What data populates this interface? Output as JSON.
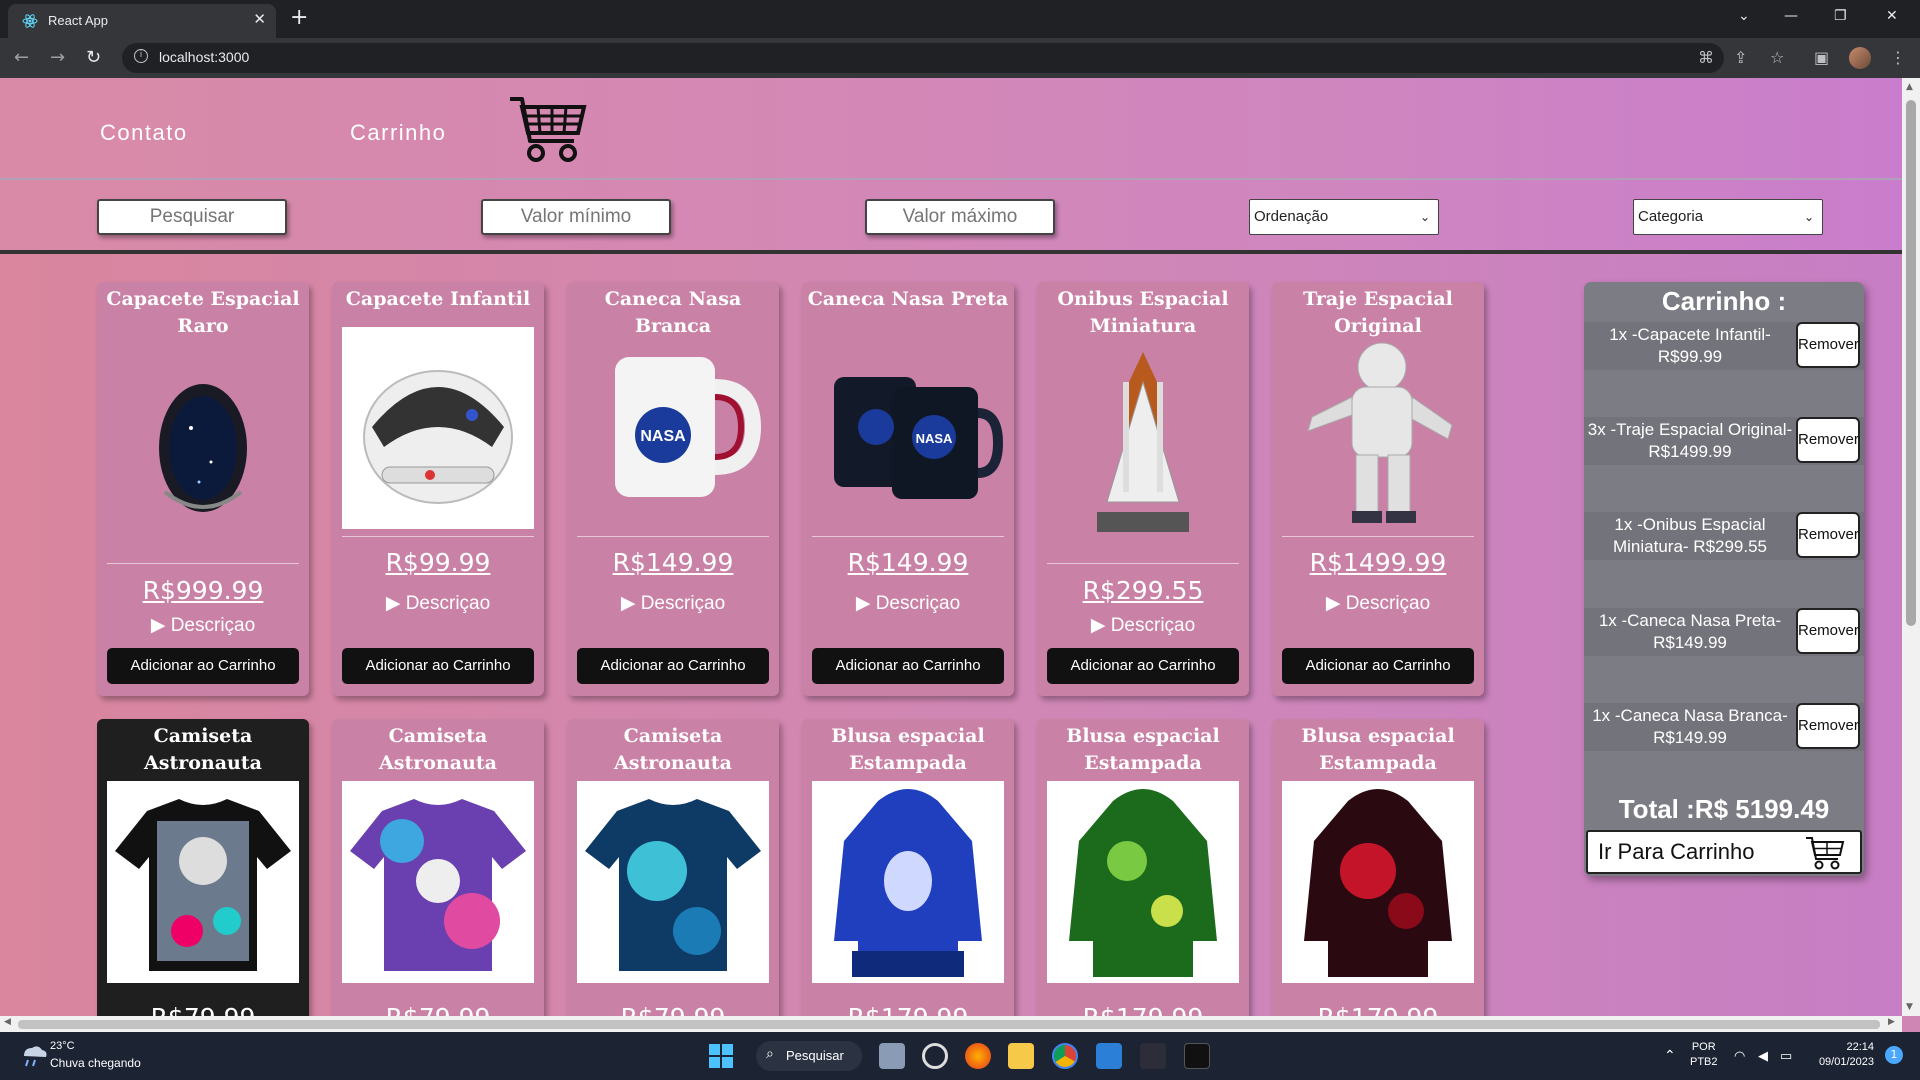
{
  "browser": {
    "tab_title": "React App",
    "tab_close": "✕",
    "new_tab": "+",
    "url": "localhost:3000",
    "window_controls": [
      "⌄",
      "—",
      "❐",
      "✕"
    ]
  },
  "nav": {
    "links": [
      "Contato",
      "Carrinho"
    ],
    "cart_icon": "shopping-cart-icon"
  },
  "filters": {
    "search_placeholder": "Pesquisar",
    "min_placeholder": "Valor mínimo",
    "max_placeholder": "Valor máximo",
    "sort_selected": "Ordenação",
    "category_selected": "Categoria"
  },
  "products": [
    {
      "name": "Capacete Espacial Raro",
      "price": "R$999.99",
      "desc": "▶ Descriçao",
      "button": "Adicionar ao Carrinho",
      "icon": "dark-space-helmet"
    },
    {
      "name": "Capacete Infantil",
      "price": "R$99.99",
      "desc": "▶ Descriçao",
      "button": "Adicionar ao Carrinho",
      "icon": "kids-helmet"
    },
    {
      "name": "Caneca Nasa Branca",
      "price": "R$149.99",
      "desc": "▶ Descriçao",
      "button": "Adicionar ao Carrinho",
      "icon": "white-nasa-mug"
    },
    {
      "name": "Caneca Nasa Preta",
      "price": "R$149.99",
      "desc": "▶ Descriçao",
      "button": "Adicionar ao Carrinho",
      "icon": "black-nasa-mugs"
    },
    {
      "name": "Onibus Espacial Miniatura",
      "price": "R$299.55",
      "desc": "▶ Descriçao",
      "button": "Adicionar ao Carrinho",
      "icon": "space-shuttle-model"
    },
    {
      "name": "Traje Espacial Original",
      "price": "R$1499.99",
      "desc": "▶ Descriçao",
      "button": "Adicionar ao Carrinho",
      "icon": "astronaut-suit"
    },
    {
      "name": "Camiseta Astronauta Estampada",
      "price": "R$79.99",
      "icon": "astronaut-tshirt-black"
    },
    {
      "name": "Camiseta Astronauta Estampada",
      "price": "R$79.99",
      "icon": "astronaut-tshirt-galaxy"
    },
    {
      "name": "Camiseta Astronauta Estampada",
      "price": "R$79.99",
      "icon": "tshirt-blue-galaxy"
    },
    {
      "name": "Blusa espacial Estampada",
      "price": "R$179.99",
      "icon": "hoodie-blue"
    },
    {
      "name": "Blusa espacial Estampada",
      "price": "R$179.99",
      "icon": "hoodie-green"
    },
    {
      "name": "Blusa espacial Estampada",
      "price": "R$179.99",
      "icon": "hoodie-red"
    }
  ],
  "cart": {
    "title": "Carrinho :",
    "items": [
      {
        "line1": "1x -Capacete Infantil-",
        "line2": "R$99.99",
        "remove": "Remover"
      },
      {
        "line1": "3x -Traje Espacial Original-",
        "line2": "R$1499.99",
        "remove": "Remover"
      },
      {
        "line1": "1x -Onibus Espacial",
        "line2": "Miniatura- R$299.55",
        "remove": "Remover"
      },
      {
        "line1": "1x -Caneca Nasa Preta-",
        "line2": "R$149.99",
        "remove": "Remover"
      },
      {
        "line1": "1x -Caneca Nasa Branca-",
        "line2": "R$149.99",
        "remove": "Remover"
      }
    ],
    "total": "Total :R$ 5199.49",
    "go_button": "Ir Para Carrinho"
  },
  "taskbar": {
    "temp": "23°C",
    "weather": "Chuva chegando",
    "search": "Pesquisar",
    "lang1": "POR",
    "lang2": "PTB2",
    "time": "22:14",
    "date": "09/01/2023",
    "notifications": "1"
  },
  "colors": {
    "page_accent": "#cf86b4",
    "card_bg": "#c981a5",
    "cart_bg": "#7c7c84",
    "button_dark": "#111111"
  }
}
